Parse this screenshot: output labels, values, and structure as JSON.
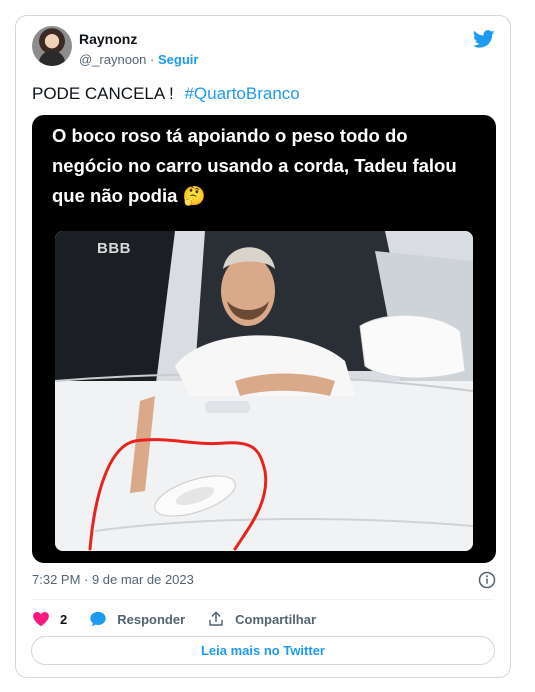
{
  "author": {
    "name": "Raynonz",
    "handle": "@_raynoon",
    "separator": "·",
    "follow_label": "Seguir"
  },
  "tweet": {
    "text": "PODE CANCELA !",
    "hashtag": "#QuartoBranco"
  },
  "media": {
    "caption": "O boco roso tá apoiando o peso todo do negócio no carro usando a corda, Tadeu falou que não podia 🤔",
    "watermark": "BBB"
  },
  "meta": {
    "timestamp": "7:32 PM · 9 de mar de 2023"
  },
  "actions": {
    "like_count": "2",
    "reply_label": "Responder",
    "share_label": "Compartilhar"
  },
  "read_more_label": "Leia mais no Twitter",
  "colors": {
    "accent": "#1d9bf0",
    "like": "#f91880",
    "text_secondary": "#536471",
    "annotation": "#e8231f"
  },
  "icons": [
    "twitter-bird-icon",
    "info-icon",
    "heart-icon",
    "reply-bubble-icon",
    "share-icon"
  ]
}
